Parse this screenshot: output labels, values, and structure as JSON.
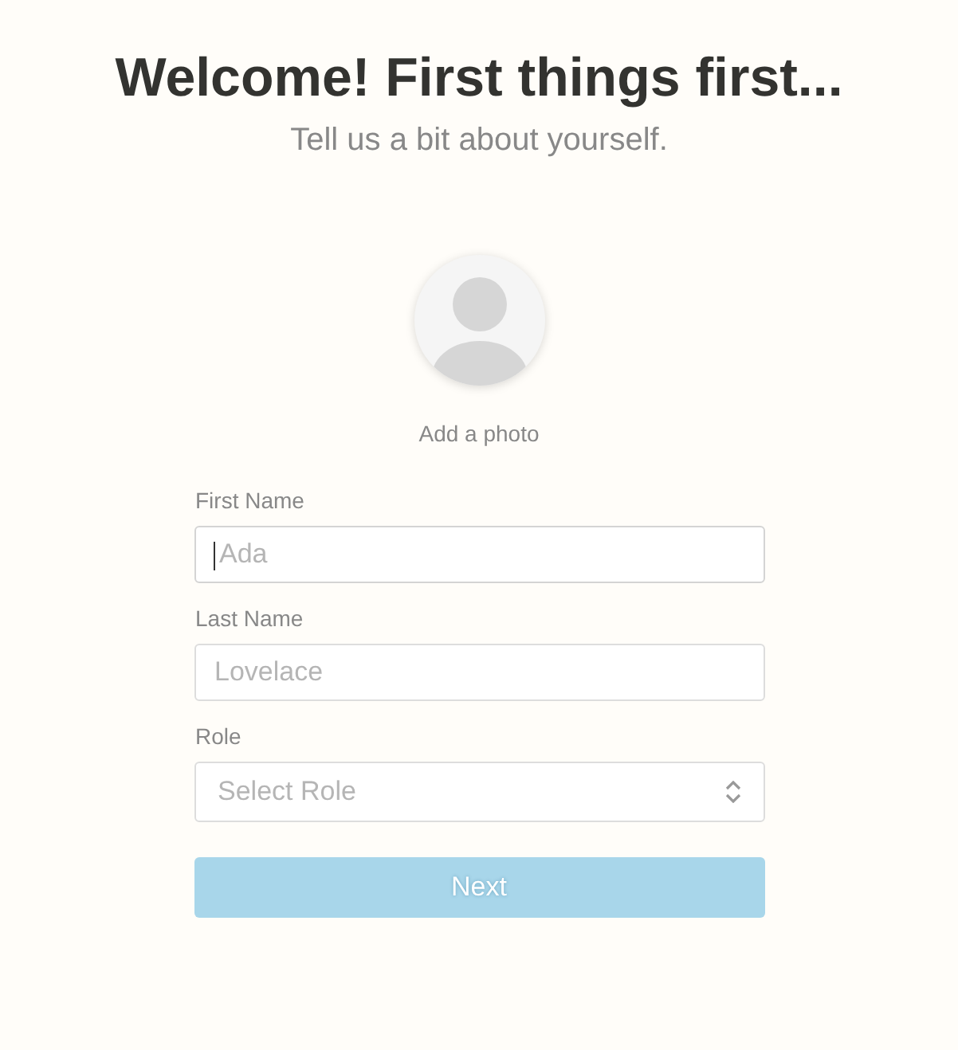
{
  "title": "Welcome! First things first...",
  "subtitle": "Tell us a bit about yourself.",
  "photo": {
    "label": "Add a photo"
  },
  "fields": [
    {
      "kind": "input",
      "label": "First Name",
      "placeholder": "Ada",
      "focused": true
    },
    {
      "kind": "input",
      "label": "Last Name",
      "placeholder": "Lovelace",
      "focused": false
    },
    {
      "kind": "select",
      "label": "Role",
      "placeholder": "Select Role",
      "focused": false
    }
  ],
  "next_button": {
    "label": "Next",
    "disabled": true
  }
}
